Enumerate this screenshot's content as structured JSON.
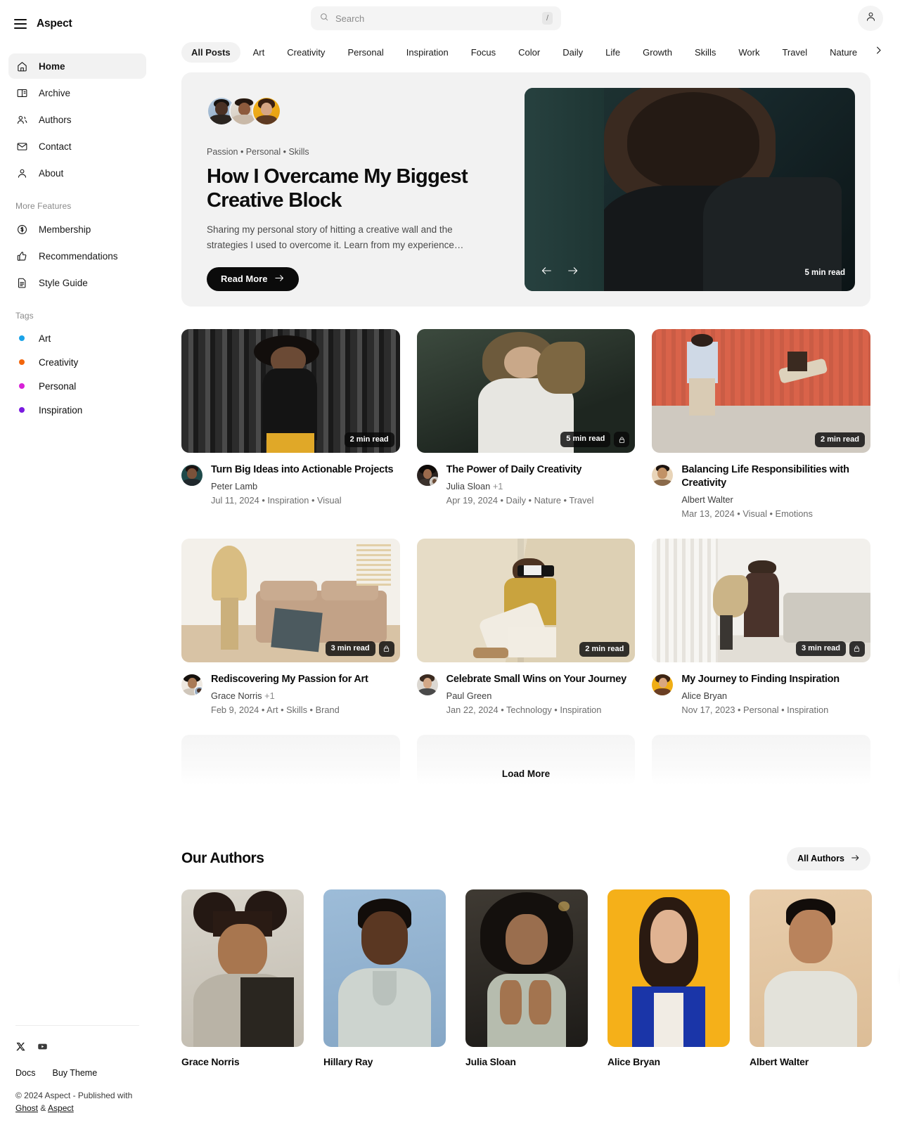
{
  "brand": {
    "title": "Aspect",
    "menu_icon": "hamburger-icon"
  },
  "search": {
    "placeholder": "Search",
    "shortcut": "/",
    "icon": "search-icon"
  },
  "account": {
    "icon": "user-icon"
  },
  "sidebar": {
    "nav": [
      {
        "label": "Home",
        "icon": "home-icon",
        "active": true
      },
      {
        "label": "Archive",
        "icon": "book-icon",
        "active": false
      },
      {
        "label": "Authors",
        "icon": "users-icon",
        "active": false
      },
      {
        "label": "Contact",
        "icon": "mail-icon",
        "active": false
      },
      {
        "label": "About",
        "icon": "person-icon",
        "active": false
      }
    ],
    "more_features_label": "More Features",
    "features": [
      {
        "label": "Membership",
        "icon": "dollar-circle-icon"
      },
      {
        "label": "Recommendations",
        "icon": "thumbs-up-icon"
      },
      {
        "label": "Style Guide",
        "icon": "document-icon"
      }
    ],
    "tags_label": "Tags",
    "tags": [
      {
        "label": "Art",
        "color": "#1aa3e8"
      },
      {
        "label": "Creativity",
        "color": "#f2650c"
      },
      {
        "label": "Personal",
        "color": "#d721d7"
      },
      {
        "label": "Inspiration",
        "color": "#7a1ae0"
      }
    ],
    "footer": {
      "socials": [
        "x-icon",
        "youtube-icon"
      ],
      "links": [
        "Docs",
        "Buy Theme"
      ],
      "copyright_prefix": "© 2024 Aspect - Published with ",
      "ghost_link": "Ghost",
      "amp": " & ",
      "aspect_link": "Aspect"
    }
  },
  "tagbar": {
    "items": [
      "All Posts",
      "Art",
      "Creativity",
      "Personal",
      "Inspiration",
      "Focus",
      "Color",
      "Daily",
      "Life",
      "Growth",
      "Skills",
      "Work",
      "Travel",
      "Nature"
    ],
    "active": "All Posts",
    "next_icon": "chevron-right-icon"
  },
  "hero": {
    "meta": "Passion  •  Personal  •  Skills",
    "title": "How I Overcame My Biggest Creative Block",
    "excerpt": "Sharing my personal story of hitting a creative wall and the strategies I used to overcome it. Learn from my experience…",
    "cta": "Read More",
    "cta_icon": "arrow-right-icon",
    "read_time": "5 min read",
    "prev_icon": "arrow-left-icon",
    "next_icon": "arrow-right-icon"
  },
  "posts": [
    {
      "title": "Turn Big Ideas into Actionable Projects",
      "author": "Peter Lamb",
      "extra_authors": "",
      "date_meta": "Jul 11, 2024  •  Inspiration  •  Visual",
      "read_time": "2 min read",
      "locked": false
    },
    {
      "title": "The Power of Daily Creativity",
      "author": "Julia Sloan",
      "extra_authors": "+1",
      "date_meta": "Apr 19, 2024  •  Daily  •  Nature  •  Travel",
      "read_time": "5 min read",
      "locked": true
    },
    {
      "title": "Balancing Life Responsibilities with Creativity",
      "author": "Albert Walter",
      "extra_authors": "",
      "date_meta": "Mar 13, 2024  •  Visual  •  Emotions",
      "read_time": "2 min read",
      "locked": false
    },
    {
      "title": "Rediscovering My Passion for Art",
      "author": "Grace Norris",
      "extra_authors": "+1",
      "date_meta": "Feb 9, 2024  •  Art  •  Skills  •  Brand",
      "read_time": "3 min read",
      "locked": true
    },
    {
      "title": "Celebrate Small Wins on Your Journey",
      "author": "Paul Green",
      "extra_authors": "",
      "date_meta": "Jan 22, 2024  •  Technology  •  Inspiration",
      "read_time": "2 min read",
      "locked": false
    },
    {
      "title": "My Journey to Finding Inspiration",
      "author": "Alice Bryan",
      "extra_authors": "",
      "date_meta": "Nov 17, 2023  •  Personal  •  Inspiration",
      "read_time": "3 min read",
      "locked": true
    }
  ],
  "load_more": {
    "label": "Load More"
  },
  "authors_section": {
    "title": "Our Authors",
    "all_button": "All Authors",
    "all_button_icon": "arrow-right-icon",
    "next_icon": "arrow-right-icon",
    "authors": [
      {
        "name": "Grace Norris"
      },
      {
        "name": "Hillary Ray"
      },
      {
        "name": "Julia Sloan"
      },
      {
        "name": "Alice Bryan"
      },
      {
        "name": "Albert Walter"
      }
    ]
  }
}
